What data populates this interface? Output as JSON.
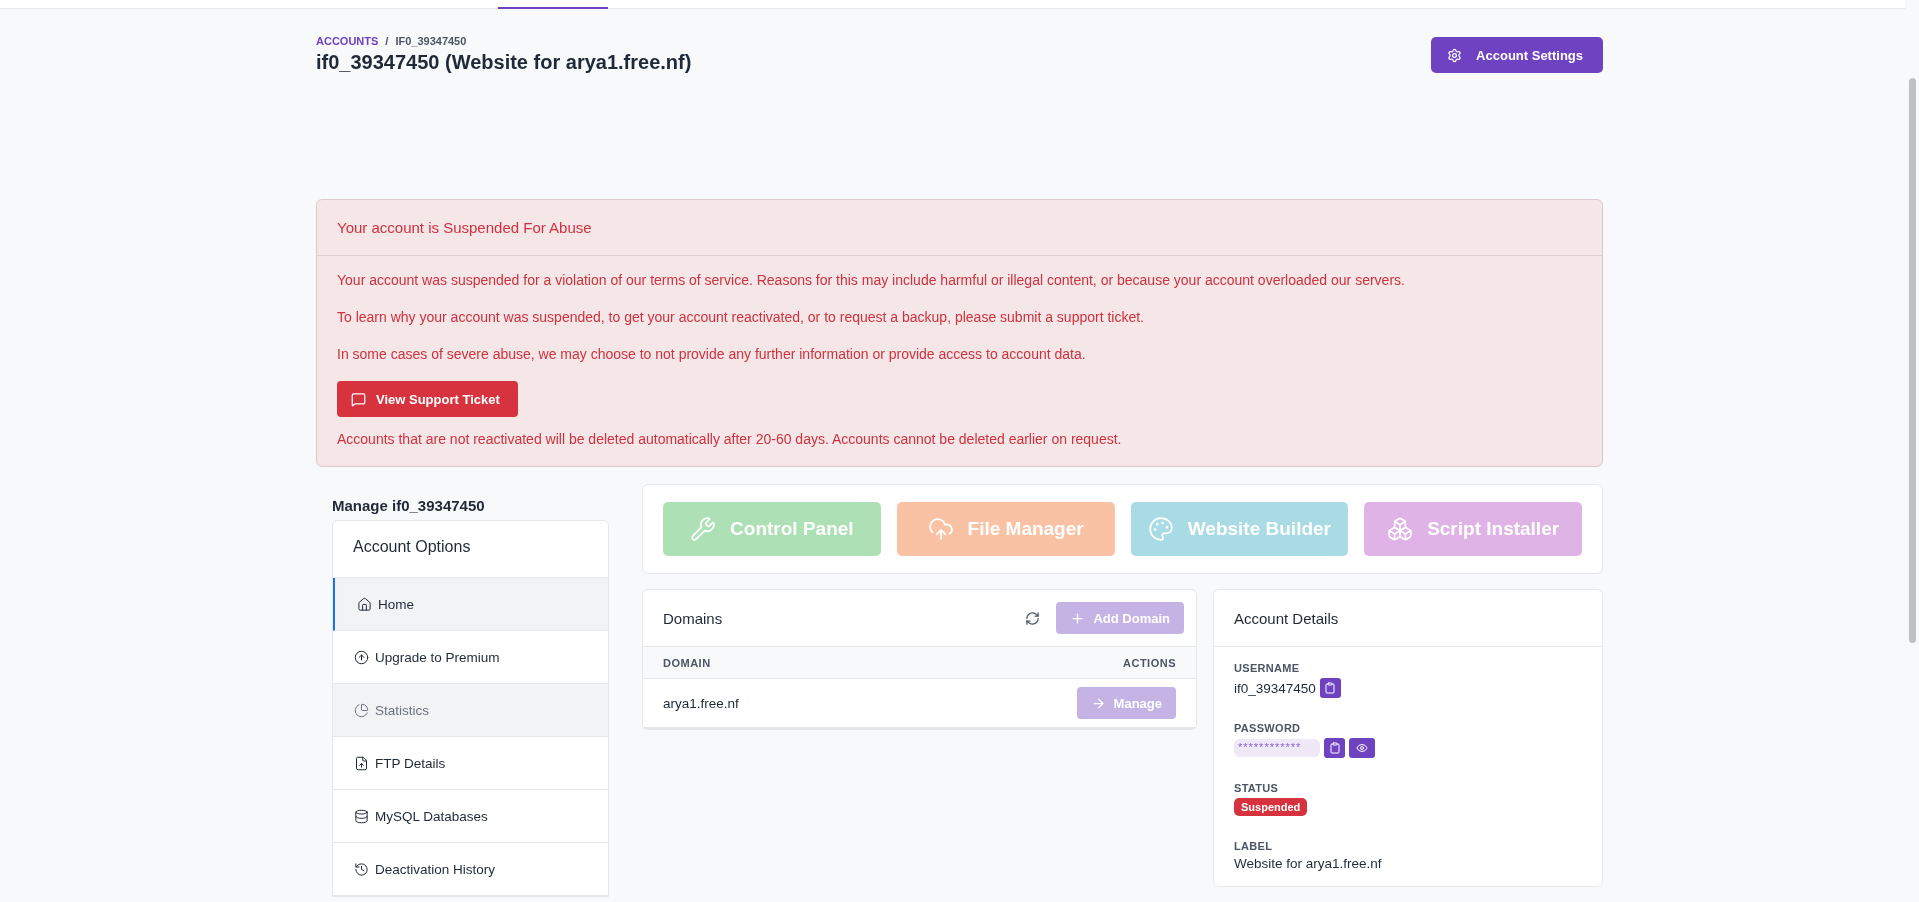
{
  "breadcrumb": [
    "ACCOUNTS",
    "IF0_39347450"
  ],
  "breadcrumb_separator": "/",
  "title": "if0_39347450 (Website for arya1.free.nf)",
  "settings_button": "Account Settings",
  "alert": {
    "title": "Your account is Suspended For Abuse",
    "paragraphs": [
      "Your account was suspended for a violation of our terms of service. Reasons for this may include harmful or illegal content, or because your account overloaded our servers.",
      "To learn why your account was suspended, to get your account reactivated, or to request a backup, please submit a support ticket.",
      "In some cases of severe abuse, we may choose to not provide any further information or provide access to account data."
    ],
    "button": "View Support Ticket",
    "footer": "Accounts that are not reactivated will be deleted automatically after 20-60 days. Accounts cannot be deleted earlier on request."
  },
  "manage_title": "Manage if0_39347450",
  "sidebar": {
    "title": "Account Options",
    "items": [
      {
        "label": "Home",
        "selected": true,
        "disabled": false
      },
      {
        "label": "Upgrade to Premium",
        "selected": false,
        "disabled": false
      },
      {
        "label": "Statistics",
        "selected": false,
        "disabled": true
      },
      {
        "label": "FTP Details",
        "selected": false,
        "disabled": false
      },
      {
        "label": "MySQL Databases",
        "selected": false,
        "disabled": false
      },
      {
        "label": "Deactivation History",
        "selected": false,
        "disabled": false
      }
    ]
  },
  "tools": [
    {
      "label": "Control Panel",
      "color": "#aee0b6"
    },
    {
      "label": "File Manager",
      "color": "#f9c2a4"
    },
    {
      "label": "Website Builder",
      "color": "#a8dbe3"
    },
    {
      "label": "Script Installer",
      "color": "#dfb3e6"
    }
  ],
  "domains": {
    "title": "Domains",
    "add_button": "Add Domain",
    "columns": [
      "DOMAIN",
      "ACTIONS"
    ],
    "rows": [
      {
        "domain": "arya1.free.nf",
        "action": "Manage"
      }
    ]
  },
  "account_details": {
    "title": "Account Details",
    "fields": [
      {
        "kind": "copy",
        "label": "USERNAME",
        "value": "if0_39347450"
      },
      {
        "kind": "password",
        "label": "PASSWORD",
        "value": "************"
      },
      {
        "kind": "badge",
        "label": "STATUS",
        "value": "Suspended"
      },
      {
        "kind": "text",
        "label": "LABEL",
        "value": "Website for arya1.free.nf"
      }
    ]
  }
}
